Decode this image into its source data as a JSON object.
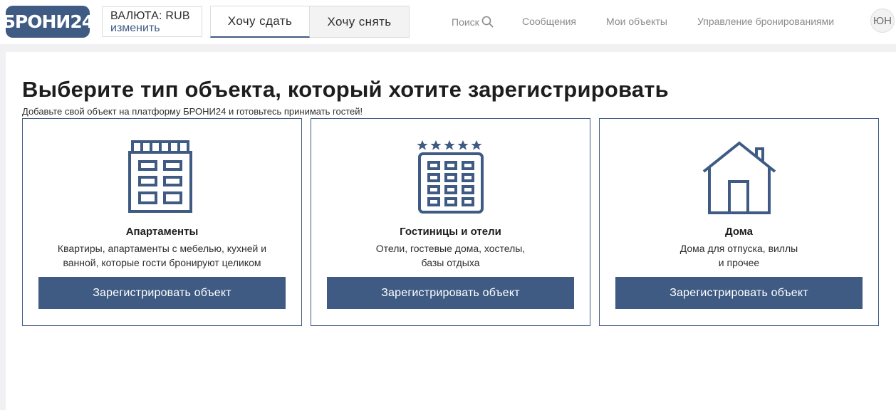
{
  "header": {
    "logo_text": "БРОНИ24",
    "currency": {
      "label": "ВАЛЮТА: RUB",
      "change_link": "изменить"
    },
    "tabs": [
      {
        "label": "Хочу сдать",
        "active": true
      },
      {
        "label": "Хочу снять",
        "active": false
      }
    ],
    "nav": {
      "search": "Поиск",
      "messages": "Сообщения",
      "my_objects": "Мои объекты",
      "booking_management": "Управление бронированиями"
    },
    "avatar_initials": "ЮН"
  },
  "page": {
    "title": "Выберите тип объекта, который хотите зарегистрировать",
    "subtitle": "Добавьте свой объект на платформу БРОНИ24 и готовьтесь принимать гостей!"
  },
  "cards": [
    {
      "icon": "apartment-building-icon",
      "title": "Апартаменты",
      "description_line1": "Квартиры, апартаменты с мебелью, кухней и",
      "description_line2": "ванной, которые гости бронируют целиком",
      "button_label": "Зарегистрировать объект"
    },
    {
      "icon": "hotel-stars-icon",
      "title": "Гостиницы и отели",
      "description_line1": "Отели, гостевые дома, хостелы,",
      "description_line2": "базы отдыха",
      "button_label": "Зарегистрировать объект"
    },
    {
      "icon": "house-icon",
      "title": "Дома",
      "description_line1": "Дома для отпуска, виллы",
      "description_line2": "и прочее",
      "button_label": "Зарегистрировать объект"
    }
  ],
  "colors": {
    "brand": "#3f5b84",
    "text": "#1d1d1d",
    "nav_text": "#8a8a8a",
    "page_background": "#f1f1f3"
  }
}
